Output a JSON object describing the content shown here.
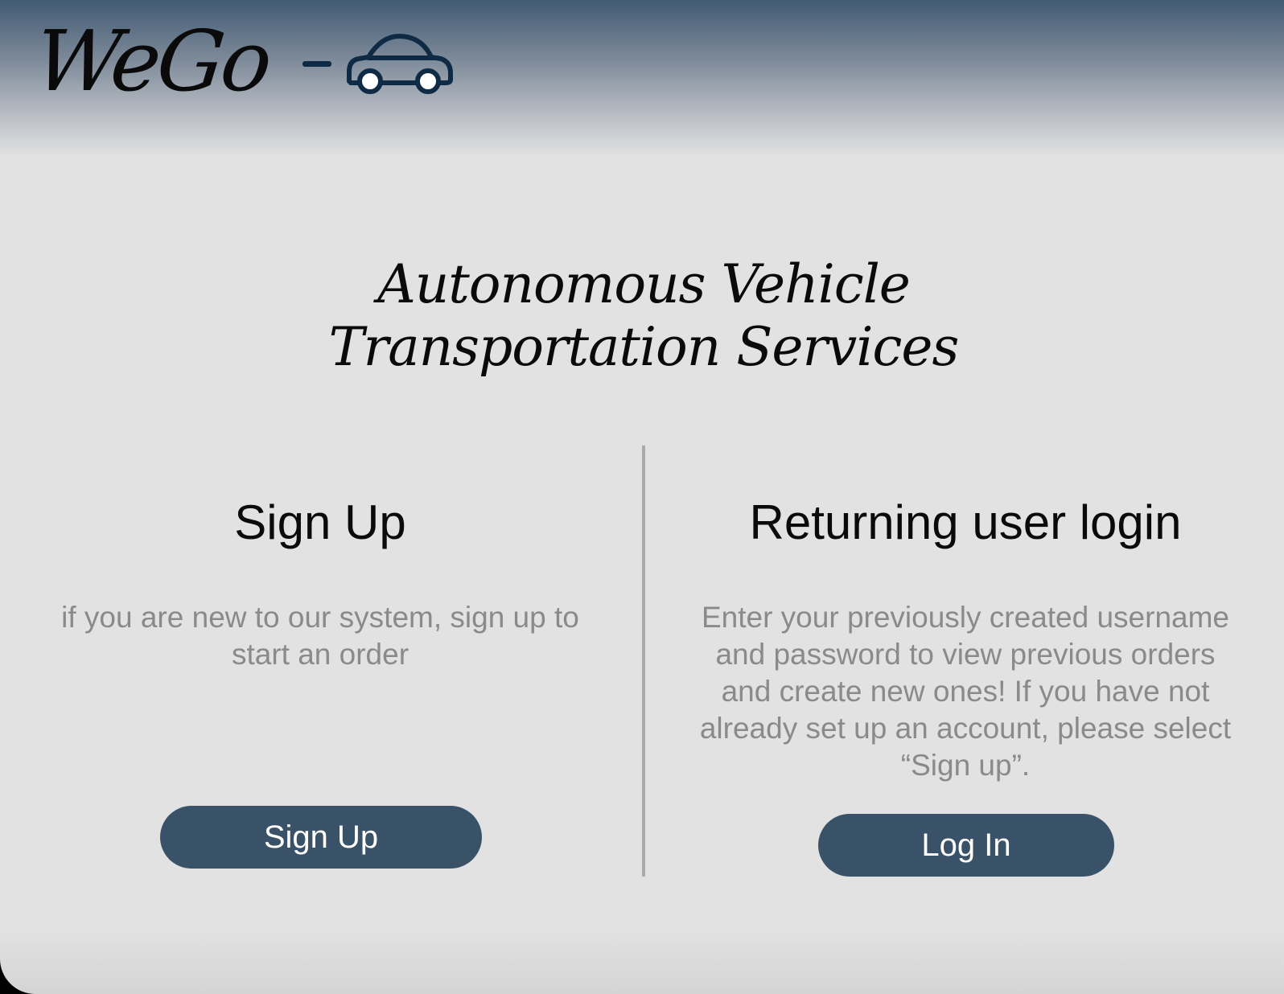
{
  "brand": {
    "name": "WeGo",
    "icon": "car-icon",
    "icon_color": "#0f2a44"
  },
  "tagline": "Autonomous Vehicle Transportation Services",
  "signup": {
    "title": "Sign Up",
    "description": "if you are new to our system, sign up to start an order",
    "button_label": "Sign Up"
  },
  "login": {
    "title": "Returning user login",
    "description": "Enter your previously created username and password to view previous orders and create new ones! If you have not already set up an account, please select “Sign up”.",
    "button_label": "Log In"
  },
  "colors": {
    "header_top": "#425a74",
    "background": "#e2e2e2",
    "button": "#3a5268",
    "button_text": "#ffffff",
    "description_text": "#8a8a8a",
    "divider": "#a9a9a9"
  }
}
